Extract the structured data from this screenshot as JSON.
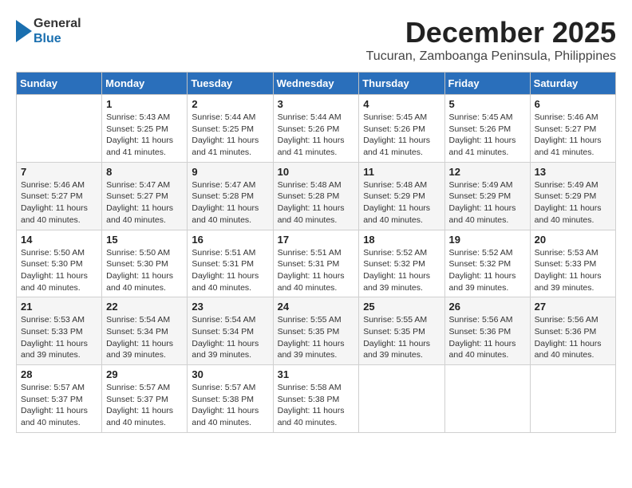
{
  "header": {
    "logo_general": "General",
    "logo_blue": "Blue",
    "month_title": "December 2025",
    "location": "Tucuran, Zamboanga Peninsula, Philippines"
  },
  "calendar": {
    "days_of_week": [
      "Sunday",
      "Monday",
      "Tuesday",
      "Wednesday",
      "Thursday",
      "Friday",
      "Saturday"
    ],
    "weeks": [
      [
        {
          "day": "",
          "info": ""
        },
        {
          "day": "1",
          "info": "Sunrise: 5:43 AM\nSunset: 5:25 PM\nDaylight: 11 hours\nand 41 minutes."
        },
        {
          "day": "2",
          "info": "Sunrise: 5:44 AM\nSunset: 5:25 PM\nDaylight: 11 hours\nand 41 minutes."
        },
        {
          "day": "3",
          "info": "Sunrise: 5:44 AM\nSunset: 5:26 PM\nDaylight: 11 hours\nand 41 minutes."
        },
        {
          "day": "4",
          "info": "Sunrise: 5:45 AM\nSunset: 5:26 PM\nDaylight: 11 hours\nand 41 minutes."
        },
        {
          "day": "5",
          "info": "Sunrise: 5:45 AM\nSunset: 5:26 PM\nDaylight: 11 hours\nand 41 minutes."
        },
        {
          "day": "6",
          "info": "Sunrise: 5:46 AM\nSunset: 5:27 PM\nDaylight: 11 hours\nand 41 minutes."
        }
      ],
      [
        {
          "day": "7",
          "info": "Sunrise: 5:46 AM\nSunset: 5:27 PM\nDaylight: 11 hours\nand 40 minutes."
        },
        {
          "day": "8",
          "info": "Sunrise: 5:47 AM\nSunset: 5:27 PM\nDaylight: 11 hours\nand 40 minutes."
        },
        {
          "day": "9",
          "info": "Sunrise: 5:47 AM\nSunset: 5:28 PM\nDaylight: 11 hours\nand 40 minutes."
        },
        {
          "day": "10",
          "info": "Sunrise: 5:48 AM\nSunset: 5:28 PM\nDaylight: 11 hours\nand 40 minutes."
        },
        {
          "day": "11",
          "info": "Sunrise: 5:48 AM\nSunset: 5:29 PM\nDaylight: 11 hours\nand 40 minutes."
        },
        {
          "day": "12",
          "info": "Sunrise: 5:49 AM\nSunset: 5:29 PM\nDaylight: 11 hours\nand 40 minutes."
        },
        {
          "day": "13",
          "info": "Sunrise: 5:49 AM\nSunset: 5:29 PM\nDaylight: 11 hours\nand 40 minutes."
        }
      ],
      [
        {
          "day": "14",
          "info": "Sunrise: 5:50 AM\nSunset: 5:30 PM\nDaylight: 11 hours\nand 40 minutes."
        },
        {
          "day": "15",
          "info": "Sunrise: 5:50 AM\nSunset: 5:30 PM\nDaylight: 11 hours\nand 40 minutes."
        },
        {
          "day": "16",
          "info": "Sunrise: 5:51 AM\nSunset: 5:31 PM\nDaylight: 11 hours\nand 40 minutes."
        },
        {
          "day": "17",
          "info": "Sunrise: 5:51 AM\nSunset: 5:31 PM\nDaylight: 11 hours\nand 40 minutes."
        },
        {
          "day": "18",
          "info": "Sunrise: 5:52 AM\nSunset: 5:32 PM\nDaylight: 11 hours\nand 39 minutes."
        },
        {
          "day": "19",
          "info": "Sunrise: 5:52 AM\nSunset: 5:32 PM\nDaylight: 11 hours\nand 39 minutes."
        },
        {
          "day": "20",
          "info": "Sunrise: 5:53 AM\nSunset: 5:33 PM\nDaylight: 11 hours\nand 39 minutes."
        }
      ],
      [
        {
          "day": "21",
          "info": "Sunrise: 5:53 AM\nSunset: 5:33 PM\nDaylight: 11 hours\nand 39 minutes."
        },
        {
          "day": "22",
          "info": "Sunrise: 5:54 AM\nSunset: 5:34 PM\nDaylight: 11 hours\nand 39 minutes."
        },
        {
          "day": "23",
          "info": "Sunrise: 5:54 AM\nSunset: 5:34 PM\nDaylight: 11 hours\nand 39 minutes."
        },
        {
          "day": "24",
          "info": "Sunrise: 5:55 AM\nSunset: 5:35 PM\nDaylight: 11 hours\nand 39 minutes."
        },
        {
          "day": "25",
          "info": "Sunrise: 5:55 AM\nSunset: 5:35 PM\nDaylight: 11 hours\nand 39 minutes."
        },
        {
          "day": "26",
          "info": "Sunrise: 5:56 AM\nSunset: 5:36 PM\nDaylight: 11 hours\nand 40 minutes."
        },
        {
          "day": "27",
          "info": "Sunrise: 5:56 AM\nSunset: 5:36 PM\nDaylight: 11 hours\nand 40 minutes."
        }
      ],
      [
        {
          "day": "28",
          "info": "Sunrise: 5:57 AM\nSunset: 5:37 PM\nDaylight: 11 hours\nand 40 minutes."
        },
        {
          "day": "29",
          "info": "Sunrise: 5:57 AM\nSunset: 5:37 PM\nDaylight: 11 hours\nand 40 minutes."
        },
        {
          "day": "30",
          "info": "Sunrise: 5:57 AM\nSunset: 5:38 PM\nDaylight: 11 hours\nand 40 minutes."
        },
        {
          "day": "31",
          "info": "Sunrise: 5:58 AM\nSunset: 5:38 PM\nDaylight: 11 hours\nand 40 minutes."
        },
        {
          "day": "",
          "info": ""
        },
        {
          "day": "",
          "info": ""
        },
        {
          "day": "",
          "info": ""
        }
      ]
    ]
  }
}
